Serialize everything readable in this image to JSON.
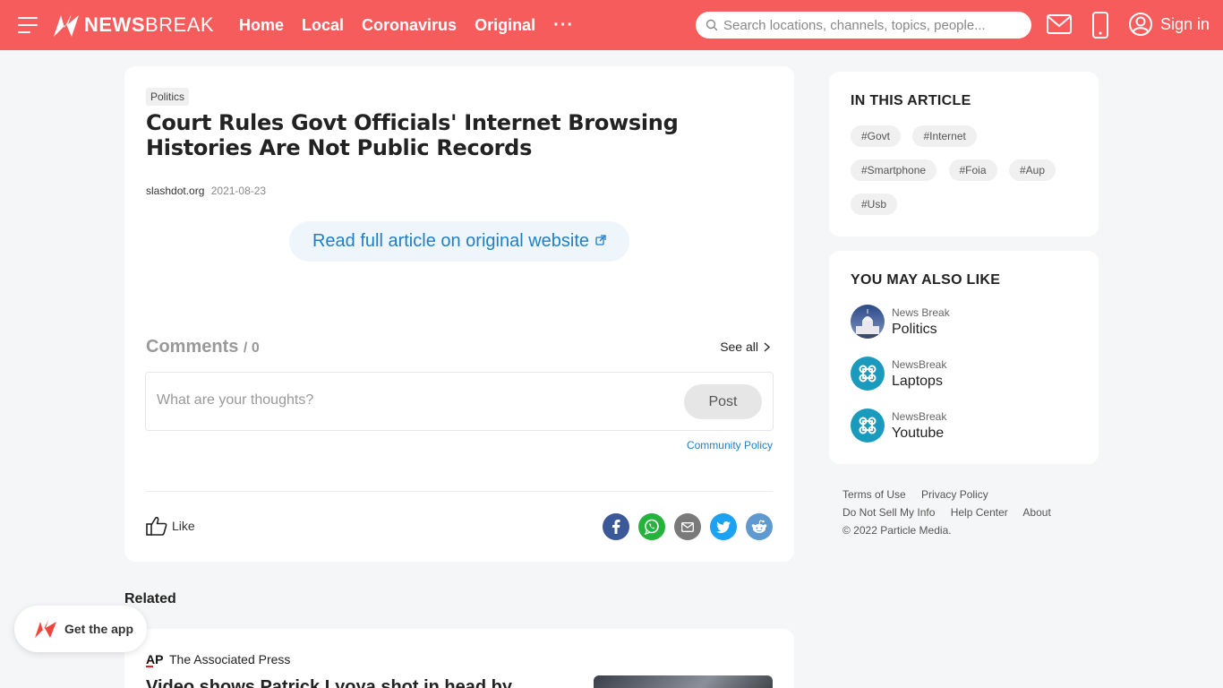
{
  "header": {
    "logo_bold": "NEWS",
    "logo_light": "BREAK",
    "nav": [
      "Home",
      "Local",
      "Coronavirus",
      "Original"
    ],
    "more_label": "···",
    "search_placeholder": "Search locations, channels, topics, people...",
    "signin_label": "Sign in"
  },
  "article": {
    "category": "Politics",
    "title": "Court Rules Govt Officials' Internet Browsing Histories Are Not Public Records",
    "source": "slashdot.org",
    "date": "2021-08-23",
    "read_full_label": "Read full article on original website",
    "comments_label": "Comments",
    "comments_count": "/ 0",
    "see_all_label": "See all",
    "comment_placeholder": "What are your thoughts?",
    "post_label": "Post",
    "community_policy_label": "Community Policy",
    "like_label": "Like"
  },
  "in_this_article": {
    "title": "IN THIS ARTICLE",
    "tags": [
      "#Govt",
      "#Internet",
      "#Smartphone",
      "#Foia",
      "#Aup",
      "#Usb"
    ]
  },
  "you_may_also_like": {
    "title": "YOU MAY ALSO LIKE",
    "items": [
      {
        "provider": "News Break",
        "name": "Politics",
        "icon": "capitol-icon"
      },
      {
        "provider": "NewsBreak",
        "name": "Laptops",
        "icon": "command-icon"
      },
      {
        "provider": "NewsBreak",
        "name": "Youtube",
        "icon": "command-icon"
      }
    ]
  },
  "footer": {
    "row1": [
      "Terms of Use",
      "Privacy Policy"
    ],
    "row2": [
      "Do Not Sell My Info",
      "Help Center",
      "About"
    ],
    "copyright": "© 2022 Particle Media."
  },
  "related": {
    "title": "Related",
    "source": "The Associated Press",
    "source_logo": "AP",
    "headline": "Video shows Patrick Lyoya shot in head by"
  },
  "get_app_label": "Get the app",
  "colors": {
    "brand": "#f65c5c",
    "link": "#1f7fc6",
    "facebook": "#3b5998",
    "whatsapp": "#25b33e",
    "email": "#7a7a7a",
    "twitter": "#1da1f2",
    "reddit": "#5f99cf"
  }
}
